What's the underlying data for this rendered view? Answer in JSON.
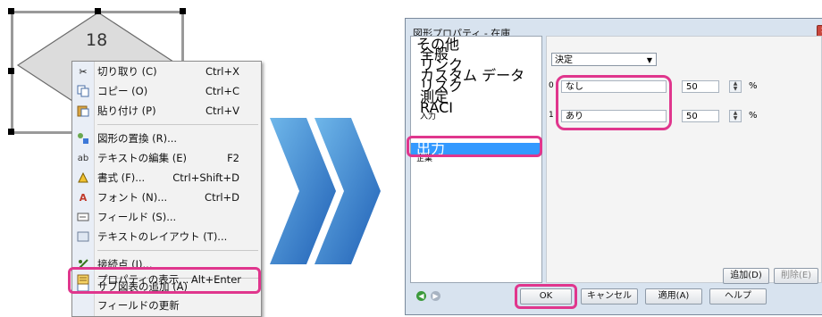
{
  "diagram": {
    "shape_number": "18"
  },
  "context_menu": {
    "items": [
      {
        "label": "切り取り (C)",
        "shortcut": "Ctrl+X",
        "icon": "scissors-icon"
      },
      {
        "label": "コピー (O)",
        "shortcut": "Ctrl+C",
        "icon": "copy-icon"
      },
      {
        "label": "貼り付け (P)",
        "shortcut": "Ctrl+V",
        "icon": "paste-icon"
      },
      {
        "label": "図形の置換 (R)...",
        "shortcut": "",
        "icon": "replace-shape-icon"
      },
      {
        "label": "テキストの編集 (E)",
        "shortcut": "F2",
        "icon": "edit-text-icon"
      },
      {
        "label": "書式 (F)...",
        "shortcut": "Ctrl+Shift+D",
        "icon": "format-icon"
      },
      {
        "label": "フォント (N)...",
        "shortcut": "Ctrl+D",
        "icon": "font-icon"
      },
      {
        "label": "フィールド (S)...",
        "shortcut": "",
        "icon": "field-icon"
      },
      {
        "label": "テキストのレイアウト (T)...",
        "shortcut": "",
        "icon": "text-layout-icon"
      },
      {
        "label": "接続点 (I)...",
        "shortcut": "",
        "icon": "connection-point-icon"
      },
      {
        "label": "サブ図表の追加 (A)",
        "shortcut": "",
        "icon": "add-subdiagram-icon"
      },
      {
        "label": "プロパティの表示...",
        "shortcut": "Alt+Enter",
        "icon": "properties-icon"
      },
      {
        "label": "フィールドの更新",
        "shortcut": "",
        "icon": ""
      }
    ]
  },
  "dialog": {
    "title": "図形プロパティ - 在庫",
    "categories": [
      "その他",
      "全般",
      "リンク",
      "カスタム データ",
      "リスク",
      "測定",
      "RACI",
      "入力",
      "出力",
      "企業"
    ],
    "selected_category": "出力",
    "combo_value": "決定",
    "rows": [
      {
        "index": "0",
        "name": "なし",
        "value": "50",
        "unit": "%"
      },
      {
        "index": "1",
        "name": "あり",
        "value": "50",
        "unit": "%"
      }
    ],
    "add_button": "追加(D)",
    "delete_button": "削除(E)",
    "ok_button": "OK",
    "cancel_button": "キャンセル",
    "apply_button": "適用(A)",
    "help_button": "ヘルプ"
  },
  "colors": {
    "highlight": "#e0368d",
    "selection": "#3399ff",
    "arrow": "#2f80d6"
  }
}
